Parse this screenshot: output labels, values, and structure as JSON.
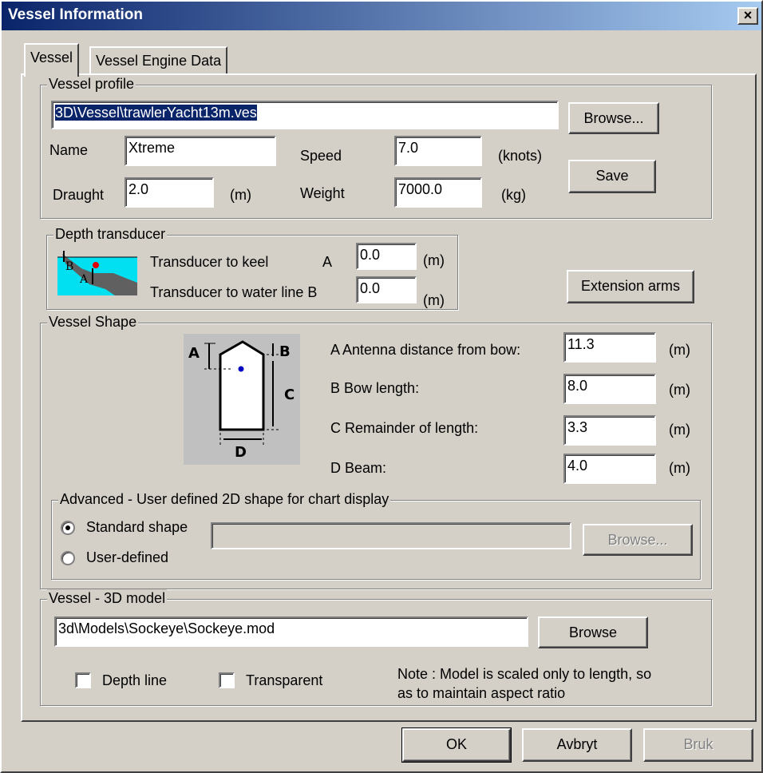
{
  "window": {
    "title": "Vessel Information",
    "close_glyph": "×"
  },
  "tabs": [
    {
      "label": "Vessel",
      "active": true
    },
    {
      "label": "Vessel Engine Data",
      "active": false
    }
  ],
  "vessel_profile": {
    "legend": "Vessel profile",
    "path": "3D\\Vessel\\trawlerYacht13m.ves",
    "browse": "Browse...",
    "save": "Save",
    "name_label": "Name",
    "name": "Xtreme",
    "speed_label": "Speed",
    "speed": "7.0",
    "speed_unit": "(knots)",
    "draught_label": "Draught",
    "draught": "2.0",
    "draught_unit": "(m)",
    "weight_label": "Weight",
    "weight": "7000.0",
    "weight_unit": "(kg)"
  },
  "depth_transducer": {
    "legend": "Depth transducer",
    "keel_label": "Transducer to keel",
    "keel_letter": "A",
    "keel": "0.0",
    "keel_unit": "(m)",
    "water_label": "Transducer to water line B",
    "water": "0.0",
    "water_unit": "(m)",
    "img_letter_a": "A",
    "img_letter_b": "B"
  },
  "extension_arms": "Extension arms",
  "vessel_shape": {
    "legend": "Vessel Shape",
    "diagram": {
      "a": "A",
      "b": "B",
      "c": "C",
      "d": "D"
    },
    "fields": [
      {
        "label": "A  Antenna distance from bow:",
        "value": "11.3",
        "unit": "(m)"
      },
      {
        "label": "B  Bow length:",
        "value": "8.0",
        "unit": "(m)"
      },
      {
        "label": "C  Remainder of length:",
        "value": "3.3",
        "unit": "(m)"
      },
      {
        "label": "D  Beam:",
        "value": "4.0",
        "unit": "(m)"
      }
    ],
    "advanced": {
      "legend": "Advanced - User defined 2D shape for chart display",
      "standard": "Standard shape",
      "user_defined": "User-defined",
      "selected": "Standard shape",
      "path": "",
      "browse": "Browse..."
    }
  },
  "model3d": {
    "legend": "Vessel - 3D model",
    "path": "3d\\Models\\Sockeye\\Sockeye.mod",
    "browse": "Browse",
    "depth_line": "Depth line",
    "transparent": "Transparent",
    "note_line1": "Note : Model is scaled only to length, so",
    "note_line2": "as to maintain aspect ratio"
  },
  "buttons": {
    "ok": "OK",
    "cancel": "Avbryt",
    "apply": "Bruk"
  }
}
